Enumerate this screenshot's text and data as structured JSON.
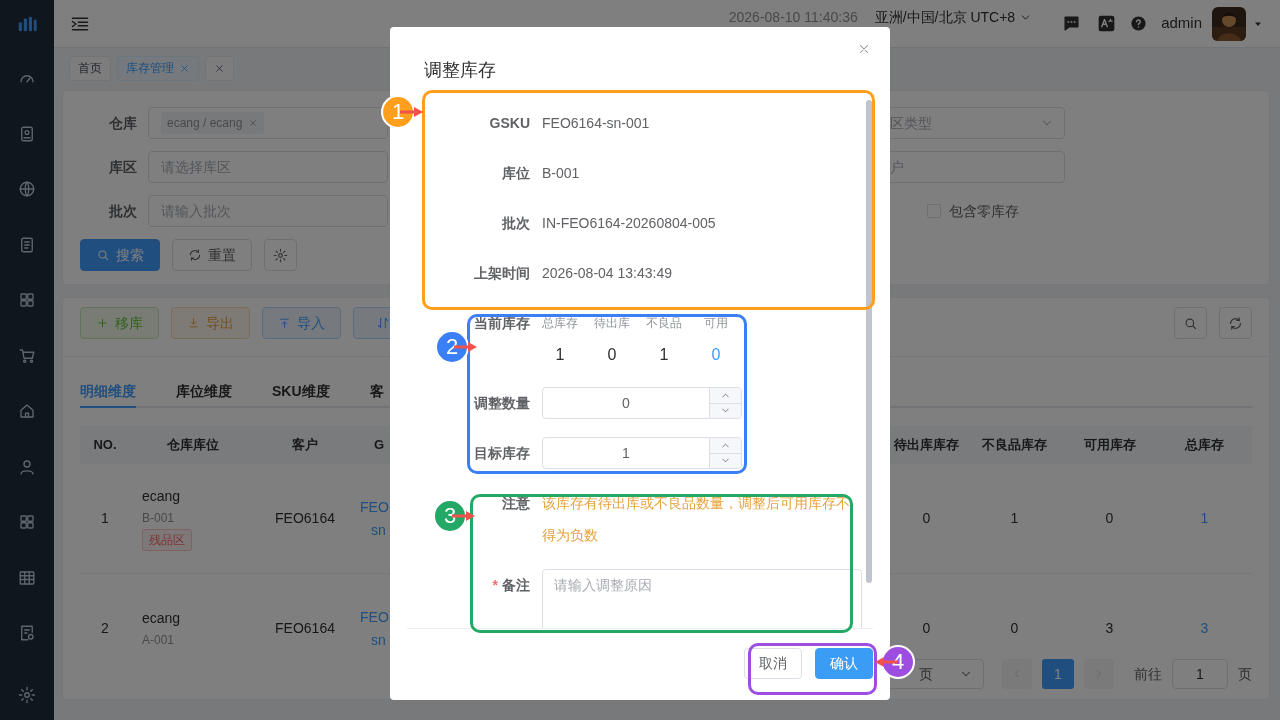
{
  "header": {
    "datetime": "2026-08-10 11:40:36",
    "timezone": "亚洲/中国/北京 UTC+8",
    "user": "admin"
  },
  "tags": [
    {
      "label": "首页",
      "selected": false,
      "closable": false
    },
    {
      "label": "库存管理",
      "selected": true,
      "closable": true
    },
    {
      "selected": false,
      "closable": true
    }
  ],
  "filters": [
    {
      "label": "仓库",
      "kind": "tags",
      "tags": [
        "ecang / ecang"
      ]
    },
    {
      "label": "库区",
      "kind": "input",
      "placeholder": "请选择库区"
    },
    {
      "label": "批次",
      "kind": "input",
      "placeholder": "请输入批次"
    }
  ],
  "filters_right": [
    {
      "kind": "select",
      "placeholder": "区类型"
    },
    {
      "kind": "input",
      "placeholder": "户"
    },
    {
      "kind": "checkbox",
      "label": "包含零库存",
      "checked": false
    }
  ],
  "filter_buttons": [
    {
      "kind": "primary",
      "label": "搜索"
    },
    {
      "kind": "default",
      "label": "重置"
    },
    {
      "kind": "settings"
    }
  ],
  "actions": [
    {
      "kind": "success",
      "label": "移库"
    },
    {
      "kind": "warning",
      "label": "导出"
    },
    {
      "kind": "info",
      "label": "导入"
    },
    {
      "kind": "sort"
    }
  ],
  "view_tabs": [
    {
      "label": "明细维度",
      "selected": true
    },
    {
      "label": "库位维度",
      "selected": false
    },
    {
      "label": "SKU维度",
      "selected": false
    },
    {
      "label": "客",
      "selected": false
    }
  ],
  "table": {
    "columns_left": [
      "NO.",
      "仓库库位",
      "客户",
      "G"
    ],
    "columns_right": [
      "待出库库存",
      "不良品库存",
      "可用库存",
      "总库存"
    ],
    "rows": [
      {
        "no": "1",
        "warehouse": "ecang",
        "location": "B-001",
        "zone": {
          "label": "残品区"
        },
        "customer": "FEO6164",
        "gsku": [
          "FEO",
          "sn"
        ],
        "pending": "0",
        "defective": "1",
        "available": "0",
        "total": "1"
      },
      {
        "no": "2",
        "warehouse": "ecang",
        "location": "A-001",
        "customer": "FEO6164",
        "gsku": [
          "FEO",
          "sn"
        ],
        "pending": "0",
        "defective": "0",
        "available": "3",
        "total": "3"
      }
    ]
  },
  "pagination": {
    "page_size": "页",
    "pages": [
      {
        "label": "1",
        "selected": true
      }
    ],
    "goto_label": "前往",
    "goto_value": "1",
    "goto_suffix": "页"
  },
  "dialog": {
    "title": "调整库存",
    "info": [
      {
        "label": "GSKU",
        "value": "FEO6164-sn-001"
      },
      {
        "label": "库位",
        "value": "B-001"
      },
      {
        "label": "批次",
        "value": "IN-FEO6164-20260804-005"
      },
      {
        "label": "上架时间",
        "value": "2026-08-04 13:43:49"
      }
    ],
    "current_stock": {
      "label": "当前库存",
      "columns": [
        {
          "label": "总库存",
          "value": "1",
          "highlight": false
        },
        {
          "label": "待出库",
          "value": "0",
          "highlight": false
        },
        {
          "label": "不良品",
          "value": "1",
          "highlight": false
        },
        {
          "label": "可用",
          "value": "0",
          "highlight": true
        }
      ]
    },
    "number_fields": [
      {
        "label": "调整数量",
        "value": "0"
      },
      {
        "label": "目标库存",
        "value": "1"
      }
    ],
    "notice": {
      "label": "注意",
      "text": "该库存有待出库或不良品数量，调整后可用库存不得为负数"
    },
    "remark": {
      "label": "备注",
      "required_mark": "*",
      "placeholder": "请输入调整原因"
    },
    "buttons": [
      {
        "kind": "default",
        "label": "取消"
      },
      {
        "kind": "primary",
        "label": "确认"
      }
    ]
  },
  "annotations": [
    {
      "number": "1",
      "color": "#ff9f1c"
    },
    {
      "number": "2",
      "color": "#3a7ff5"
    },
    {
      "number": "3",
      "color": "#24a866"
    },
    {
      "number": "4",
      "color": "#9d4ee0"
    }
  ]
}
